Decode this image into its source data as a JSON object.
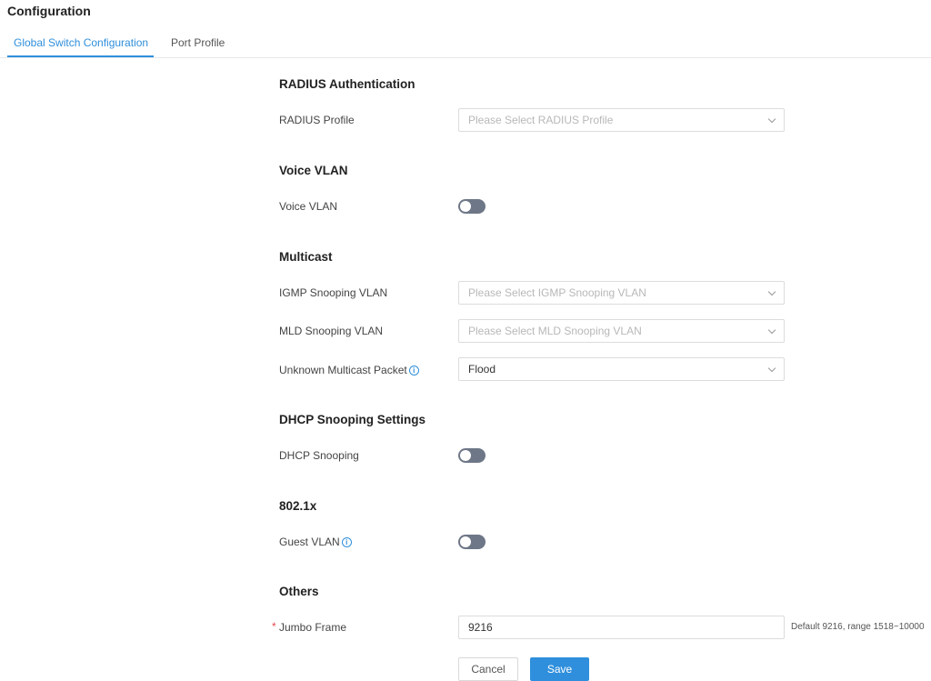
{
  "page": {
    "title": "Configuration"
  },
  "tabs": [
    {
      "label": "Global Switch Configuration",
      "active": true
    },
    {
      "label": "Port Profile",
      "active": false
    }
  ],
  "sections": {
    "radius": {
      "title": "RADIUS Authentication",
      "profile_label": "RADIUS Profile",
      "profile_placeholder": "Please Select RADIUS Profile"
    },
    "voice_vlan": {
      "title": "Voice VLAN",
      "label": "Voice VLAN",
      "enabled": false
    },
    "multicast": {
      "title": "Multicast",
      "igmp_label": "IGMP Snooping VLAN",
      "igmp_placeholder": "Please Select IGMP Snooping VLAN",
      "mld_label": "MLD Snooping VLAN",
      "mld_placeholder": "Please Select MLD Snooping VLAN",
      "unknown_label": "Unknown Multicast Packet",
      "unknown_value": "Flood",
      "info_glyph": "i"
    },
    "dhcp": {
      "title": "DHCP Snooping Settings",
      "label": "DHCP Snooping",
      "enabled": false
    },
    "dot1x": {
      "title": "802.1x",
      "guest_label": "Guest VLAN",
      "enabled": false,
      "info_glyph": "i"
    },
    "others": {
      "title": "Others",
      "required_mark": "*",
      "jumbo_label": "Jumbo Frame",
      "jumbo_value": "9216",
      "jumbo_hint": "Default 9216, range 1518~10000"
    }
  },
  "actions": {
    "cancel_label": "Cancel",
    "save_label": "Save"
  },
  "colors": {
    "accent": "#2f8fdc",
    "toggle_off": "#6e7787",
    "required": "#e5484d"
  }
}
